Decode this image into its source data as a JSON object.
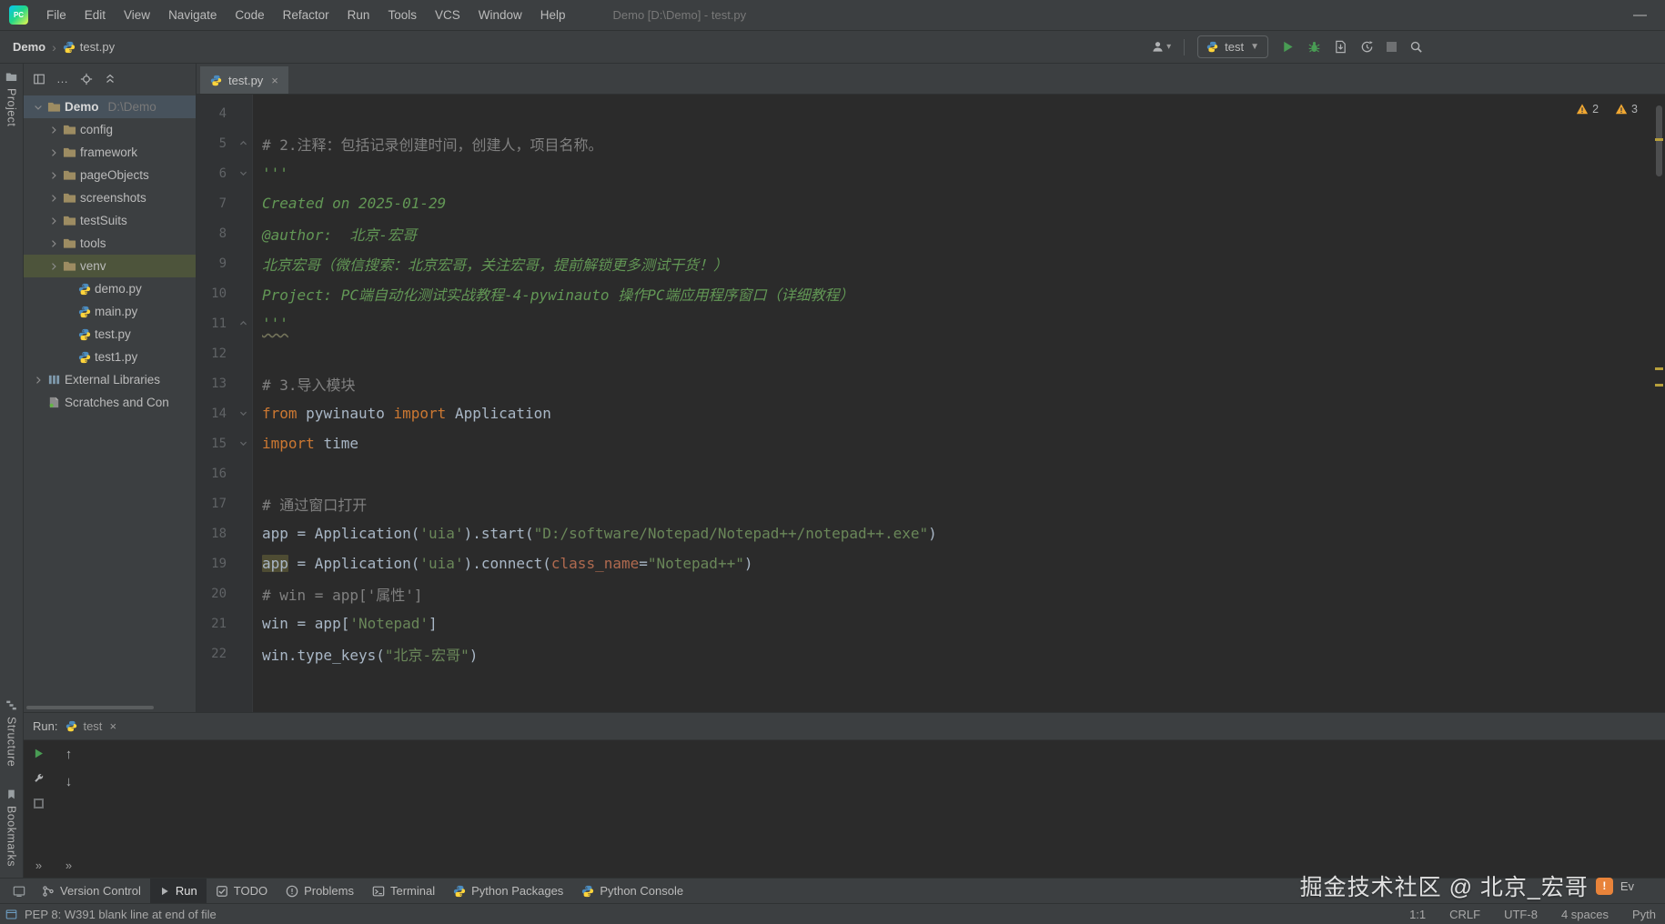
{
  "colors": {
    "panel_bg": "#3c3f41",
    "editor_bg": "#2b2b2b",
    "run_green": "#499c54",
    "warning_yellow": "#f0a732",
    "keyword_orange": "#cc7832",
    "string_green": "#6a8759",
    "docstring_green": "#629755",
    "comment_gray": "#808080",
    "selection_blue_gray": "#47525c",
    "venv_highlight": "#4d543b"
  },
  "window": {
    "title": "Demo [D:\\Demo] - test.py",
    "minimize": "—"
  },
  "menu_bar": {
    "logo_text": "PC",
    "items": [
      "File",
      "Edit",
      "View",
      "Navigate",
      "Code",
      "Refactor",
      "Run",
      "Tools",
      "VCS",
      "Window",
      "Help"
    ]
  },
  "nav_bar": {
    "root_crumb": "Demo",
    "file_crumb": "test.py",
    "run_config": "test",
    "combo_caret": "▼"
  },
  "left_strip": {
    "project": "Project",
    "structure": "Structure",
    "bookmarks": "Bookmarks"
  },
  "project_panel": {
    "toolbar_ellipsis": "…",
    "tree": [
      {
        "label": "Demo",
        "suffix": "D:\\Demo",
        "icon": "folder",
        "chevron": "down",
        "indent": 0,
        "bold": true,
        "selected": true
      },
      {
        "label": "config",
        "icon": "folder",
        "chevron": "right",
        "indent": 1
      },
      {
        "label": "framework",
        "icon": "folder",
        "chevron": "right",
        "indent": 1
      },
      {
        "label": "pageObjects",
        "icon": "folder",
        "chevron": "right",
        "indent": 1
      },
      {
        "label": "screenshots",
        "icon": "folder",
        "chevron": "right",
        "indent": 1
      },
      {
        "label": "testSuits",
        "icon": "folder",
        "chevron": "right",
        "indent": 1
      },
      {
        "label": "tools",
        "icon": "folder",
        "chevron": "right",
        "indent": 1
      },
      {
        "label": "venv",
        "icon": "folder",
        "chevron": "right",
        "indent": 1,
        "highlighted": true
      },
      {
        "label": "demo.py",
        "icon": "python",
        "indent": 2
      },
      {
        "label": "main.py",
        "icon": "python",
        "indent": 2
      },
      {
        "label": "test.py",
        "icon": "python",
        "indent": 2
      },
      {
        "label": "test1.py",
        "icon": "python",
        "indent": 2
      },
      {
        "label": "External Libraries",
        "icon": "libraries",
        "chevron": "right",
        "indent": 0
      },
      {
        "label": "Scratches and Con",
        "icon": "scratches",
        "indent": 0
      }
    ]
  },
  "editor": {
    "tab": "test.py",
    "close": "×",
    "badges": [
      "2",
      "3"
    ],
    "lines": [
      {
        "n": "4",
        "tokens": []
      },
      {
        "n": "5",
        "fold": "up",
        "tokens": [
          {
            "t": "# 2.注释：包括记录创建时间，创建人，项目名称。",
            "c": "comment"
          }
        ]
      },
      {
        "n": "6",
        "fold": "down",
        "tokens": [
          {
            "t": "'''",
            "c": "doc"
          }
        ]
      },
      {
        "n": "7",
        "tokens": [
          {
            "t": "Created on 2025-01-29",
            "c": "doc"
          }
        ]
      },
      {
        "n": "8",
        "tokens": [
          {
            "t": "@author:  北京-宏哥",
            "c": "doc"
          }
        ]
      },
      {
        "n": "9",
        "tokens": [
          {
            "t": "北京宏哥（微信搜索：北京宏哥，关注宏哥，提前解锁更多测试干货！）",
            "c": "doc"
          }
        ]
      },
      {
        "n": "10",
        "tokens": [
          {
            "t": "Project: PC端自动化测试实战教程-4-pywinauto 操作PC端应用程序窗口（详细教程）",
            "c": "doc"
          }
        ]
      },
      {
        "n": "11",
        "fold": "up",
        "tokens": [
          {
            "t": "'''",
            "c": "doc",
            "squiggle": true
          }
        ]
      },
      {
        "n": "12",
        "tokens": []
      },
      {
        "n": "13",
        "tokens": [
          {
            "t": "# 3.导入模块",
            "c": "comment"
          }
        ]
      },
      {
        "n": "14",
        "fold": "down",
        "tokens": [
          {
            "t": "from ",
            "c": "kw"
          },
          {
            "t": "pywinauto ",
            "c": "plain"
          },
          {
            "t": "import ",
            "c": "kw"
          },
          {
            "t": "Application",
            "c": "plain"
          }
        ]
      },
      {
        "n": "15",
        "fold": "down",
        "tokens": [
          {
            "t": "import ",
            "c": "kw"
          },
          {
            "t": "time",
            "c": "plain"
          }
        ]
      },
      {
        "n": "16",
        "tokens": []
      },
      {
        "n": "17",
        "tokens": [
          {
            "t": "# 通过窗口打开",
            "c": "comment"
          }
        ]
      },
      {
        "n": "18",
        "tokens": [
          {
            "t": "app = Application(",
            "c": "plain"
          },
          {
            "t": "'uia'",
            "c": "str"
          },
          {
            "t": ").start(",
            "c": "plain"
          },
          {
            "t": "\"D:/software/Notepad/Notepad++/notepad++.exe\"",
            "c": "str"
          },
          {
            "t": ")",
            "c": "plain"
          }
        ]
      },
      {
        "n": "19",
        "tokens": [
          {
            "t": "app",
            "c": "plain",
            "hl": true
          },
          {
            "t": " = Application(",
            "c": "plain"
          },
          {
            "t": "'uia'",
            "c": "str"
          },
          {
            "t": ").connect(",
            "c": "plain"
          },
          {
            "t": "class_name",
            "c": "param"
          },
          {
            "t": "=",
            "c": "plain"
          },
          {
            "t": "\"Notepad++\"",
            "c": "str"
          },
          {
            "t": ")",
            "c": "plain"
          }
        ]
      },
      {
        "n": "20",
        "tokens": [
          {
            "t": "# win = app['属性']",
            "c": "comment"
          }
        ]
      },
      {
        "n": "21",
        "tokens": [
          {
            "t": "win = app[",
            "c": "plain"
          },
          {
            "t": "'Notepad'",
            "c": "str"
          },
          {
            "t": "]",
            "c": "plain"
          }
        ]
      },
      {
        "n": "22",
        "tokens": [
          {
            "t": "win.type_keys(",
            "c": "plain"
          },
          {
            "t": "\"北京-宏哥\"",
            "c": "str"
          },
          {
            "t": ")",
            "c": "plain"
          }
        ]
      }
    ]
  },
  "run_panel": {
    "label": "Run:",
    "tab": "test",
    "close": "×",
    "more": "»",
    "up_arrow": "↑",
    "down_arrow": "↓"
  },
  "bottom_bar": {
    "items": [
      {
        "label": "Version Control",
        "icon": "vcs"
      },
      {
        "label": "Run",
        "icon": "run",
        "active": true
      },
      {
        "label": "TODO",
        "icon": "todo"
      },
      {
        "label": "Problems",
        "icon": "problems"
      },
      {
        "label": "Terminal",
        "icon": "terminal"
      },
      {
        "label": "Python Packages",
        "icon": "python"
      },
      {
        "label": "Python Console",
        "icon": "python"
      }
    ],
    "event_log": "Ev"
  },
  "status_bar": {
    "message": "PEP 8: W391 blank line at end of file",
    "caret": "1:1",
    "line_sep": "CRLF",
    "encoding": "UTF-8",
    "indent": "4 spaces",
    "interpreter": "Pyth"
  },
  "watermark": "掘金技术社区 @ 北京_宏哥"
}
